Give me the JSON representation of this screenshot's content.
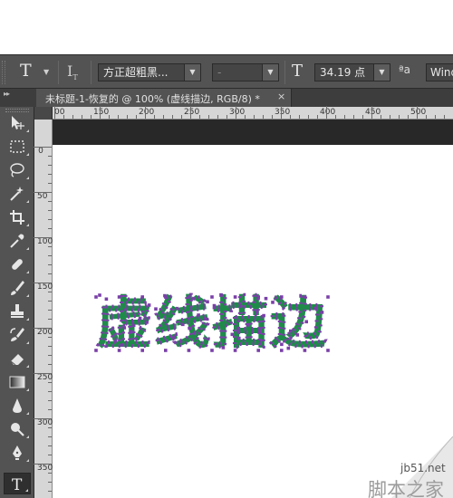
{
  "options_bar": {
    "font_family": "方正超粗黑...",
    "font_style": "-",
    "font_size": "34.19 点",
    "anti_alias_label": "ªa",
    "anti_alias_value": "Wind"
  },
  "document_tab": {
    "title": "未标题-1-恢复的 @ 100% (虚线描边, RGB/8) *",
    "close": "×"
  },
  "ruler_top": {
    "labels": [
      "00",
      "150",
      "200",
      "250",
      "300",
      "350",
      "400",
      "450",
      "500"
    ]
  },
  "ruler_left": {
    "labels": [
      "0",
      "50",
      "100",
      "150",
      "200",
      "250",
      "300",
      "350"
    ]
  },
  "canvas": {
    "text": "虚线描边",
    "text_fill": "#1f8b4a",
    "path_color": "#7a3fa8",
    "background": "#ffffff"
  },
  "toolbar": {
    "tools": [
      "move-tool-icon",
      "marquee-tool-icon",
      "lasso-tool-icon",
      "magic-wand-tool-icon",
      "crop-tool-icon",
      "eyedropper-tool-icon",
      "healing-brush-tool-icon",
      "brush-tool-icon",
      "clone-stamp-tool-icon",
      "history-brush-tool-icon",
      "eraser-tool-icon",
      "gradient-tool-icon",
      "blur-tool-icon",
      "dodge-tool-icon",
      "pen-tool-icon",
      "type-tool-icon"
    ],
    "active": "type-tool-icon"
  },
  "watermark": {
    "url": "jb51.net",
    "site": "脚本之家"
  }
}
